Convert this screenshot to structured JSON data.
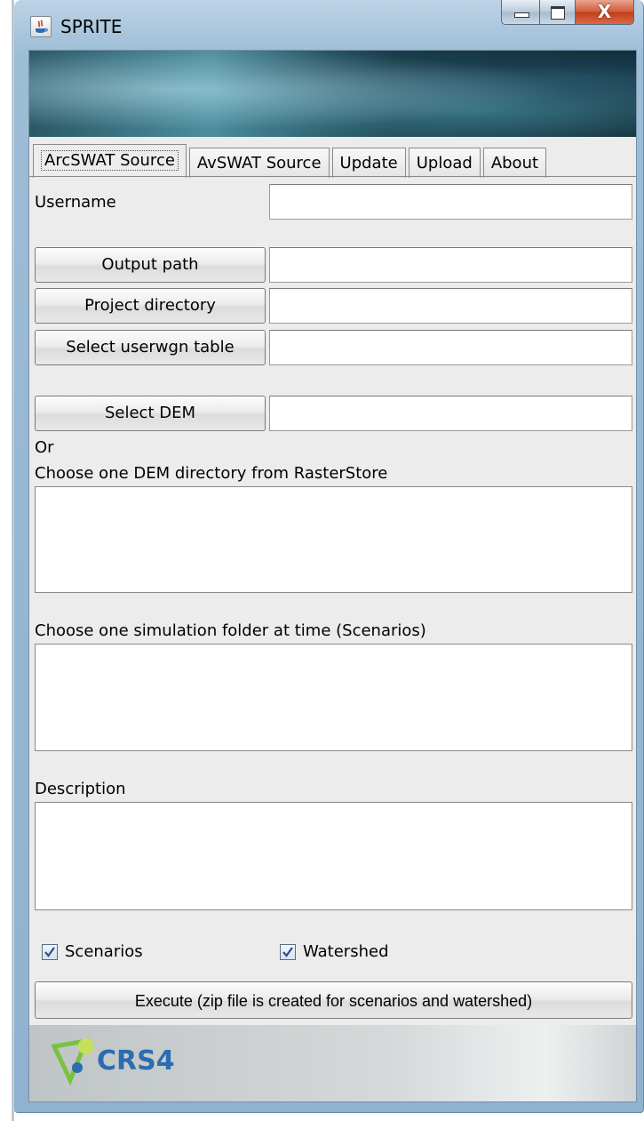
{
  "window": {
    "title": "SPRITE",
    "controls": {
      "minimize": "minimize",
      "maximize": "maximize",
      "close": "X"
    }
  },
  "tabs": [
    "ArcSWAT Source",
    "AvSWAT Source",
    "Update",
    "Upload",
    "About"
  ],
  "active_tab": "ArcSWAT Source",
  "form": {
    "username_label": "Username",
    "username_value": "",
    "output_path_button": "Output path",
    "output_path_value": "",
    "project_directory_button": "Project directory",
    "project_directory_value": "",
    "userwgn_button": "Select userwgn table",
    "userwgn_value": "",
    "dem_button": "Select DEM",
    "dem_value": "",
    "or_label": "Or",
    "dem_directory_label": "Choose one DEM directory from RasterStore",
    "simulation_label": "Choose one simulation folder at time (Scenarios)",
    "description_label": "Description",
    "description_value": ""
  },
  "checkboxes": {
    "scenarios": {
      "label": "Scenarios",
      "checked": true
    },
    "watershed": {
      "label": "Watershed",
      "checked": true
    }
  },
  "execute_button": "Execute (zip file is created for scenarios and watershed)",
  "footer": {
    "logo_text": "CRS4"
  },
  "colors": {
    "window_frame": "#9dbcd6",
    "client_bg": "#ececec",
    "logo_green": "#7ac143",
    "logo_blue": "#2a6db0",
    "close_red": "#c03e1c"
  },
  "icons": {
    "app": "java-icon",
    "check": "checkmark-icon"
  }
}
